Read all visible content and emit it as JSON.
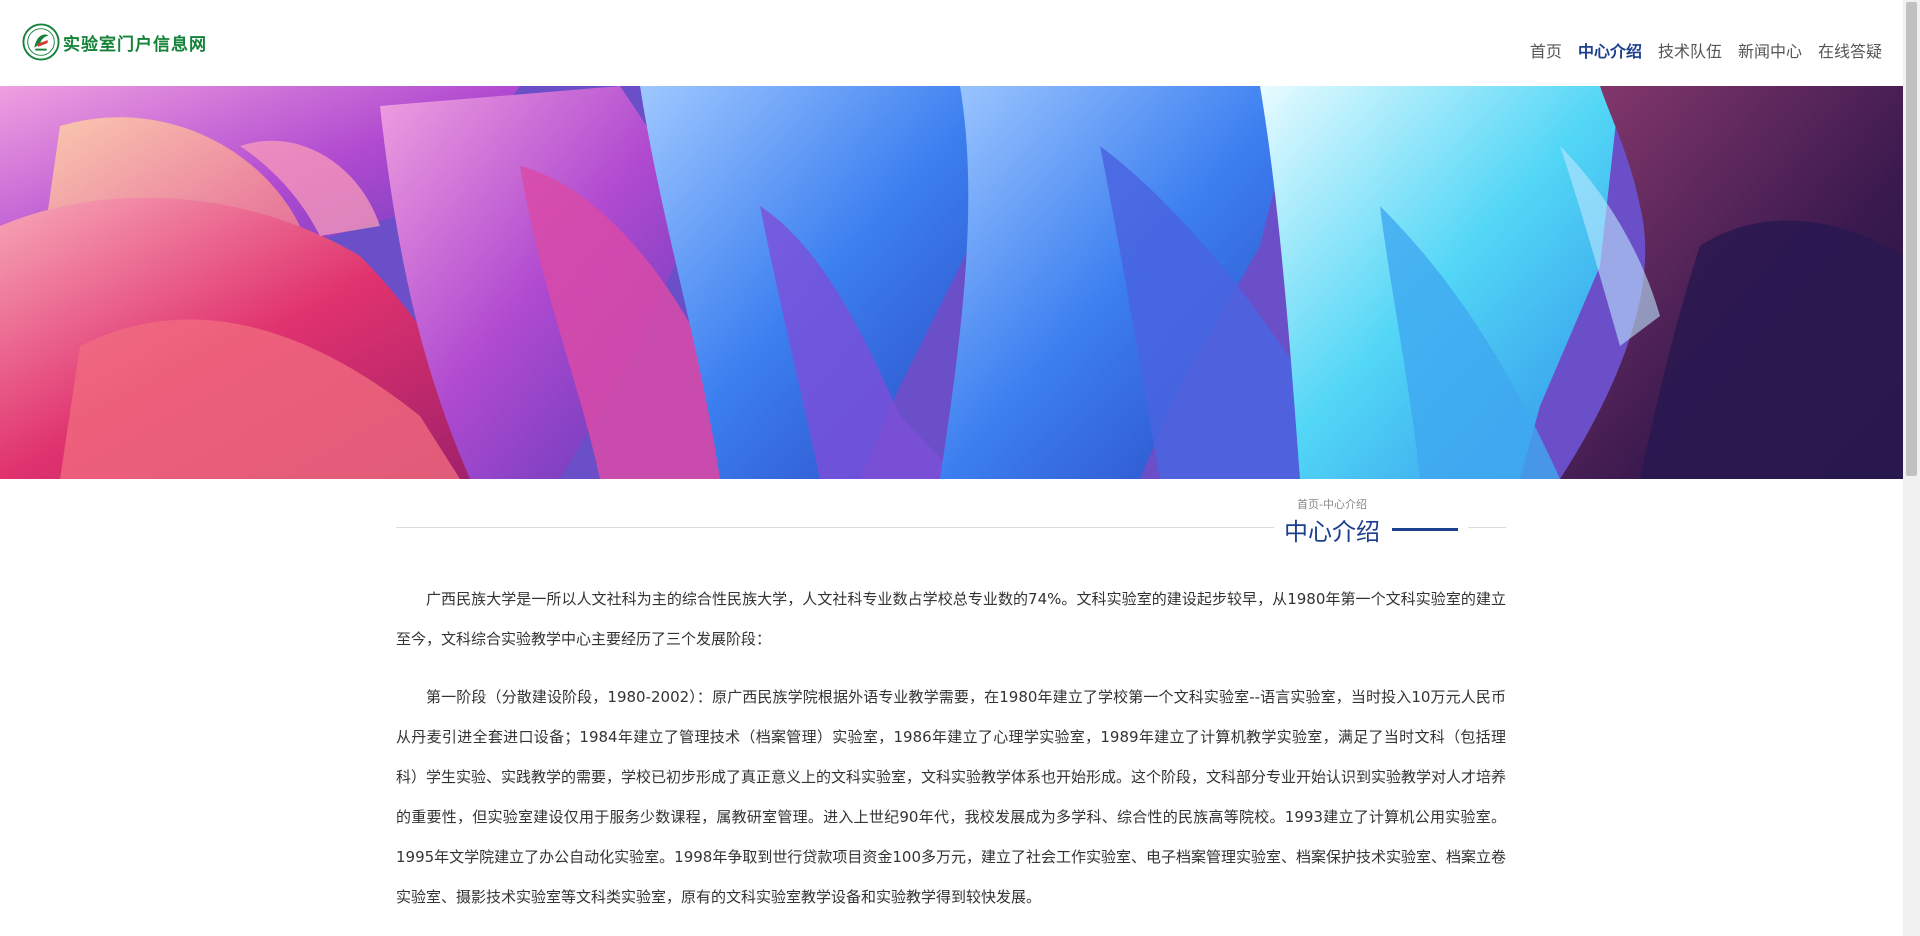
{
  "site": {
    "logo_text": "实验室门户信息网",
    "logo_icon": "university-emblem-icon"
  },
  "nav": {
    "items": [
      {
        "label": "首页",
        "active": false
      },
      {
        "label": "中心介绍",
        "active": true
      },
      {
        "label": "技术队伍",
        "active": false
      },
      {
        "label": "新闻中心",
        "active": false
      },
      {
        "label": "在线答疑",
        "active": false
      }
    ]
  },
  "page": {
    "breadcrumb": "首页-中心介绍",
    "title": "中心介绍"
  },
  "article": {
    "paragraphs": [
      "广西民族大学是一所以人文社科为主的综合性民族大学，人文社科专业数占学校总专业数的74%。文科实验室的建设起步较早，从1980年第一个文科实验室的建立至今，文科综合实验教学中心主要经历了三个发展阶段：",
      "第一阶段（分散建设阶段，1980-2002）：原广西民族学院根据外语专业教学需要，在1980年建立了学校第一个文科实验室--语言实验室，当时投入10万元人民币从丹麦引进全套进口设备；1984年建立了管理技术（档案管理）实验室，1986年建立了心理学实验室，1989年建立了计算机教学实验室，满足了当时文科（包括理科）学生实验、实践教学的需要，学校已初步形成了真正意义上的文科实验室，文科实验教学体系也开始形成。这个阶段，文科部分专业开始认识到实验教学对人才培养的重要性，但实验室建设仅用于服务少数课程，属教研室管理。进入上世纪90年代，我校发展成为多学科、综合性的民族高等院校。1993建立了计算机公用实验室。1995年文学院建立了办公自动化实验室。1998年争取到世行贷款项目资金100多万元，建立了社会工作实验室、电子档案管理实验室、档案保护技术实验室、档案立卷实验室、摄影技术实验室等文科类实验室，原有的文科实验室教学设备和实验教学得到较快发展。"
    ]
  },
  "colors": {
    "brand_green": "#15823a",
    "accent_blue": "#1d3f8f",
    "body_text": "#333333",
    "nav_text": "#555555"
  }
}
